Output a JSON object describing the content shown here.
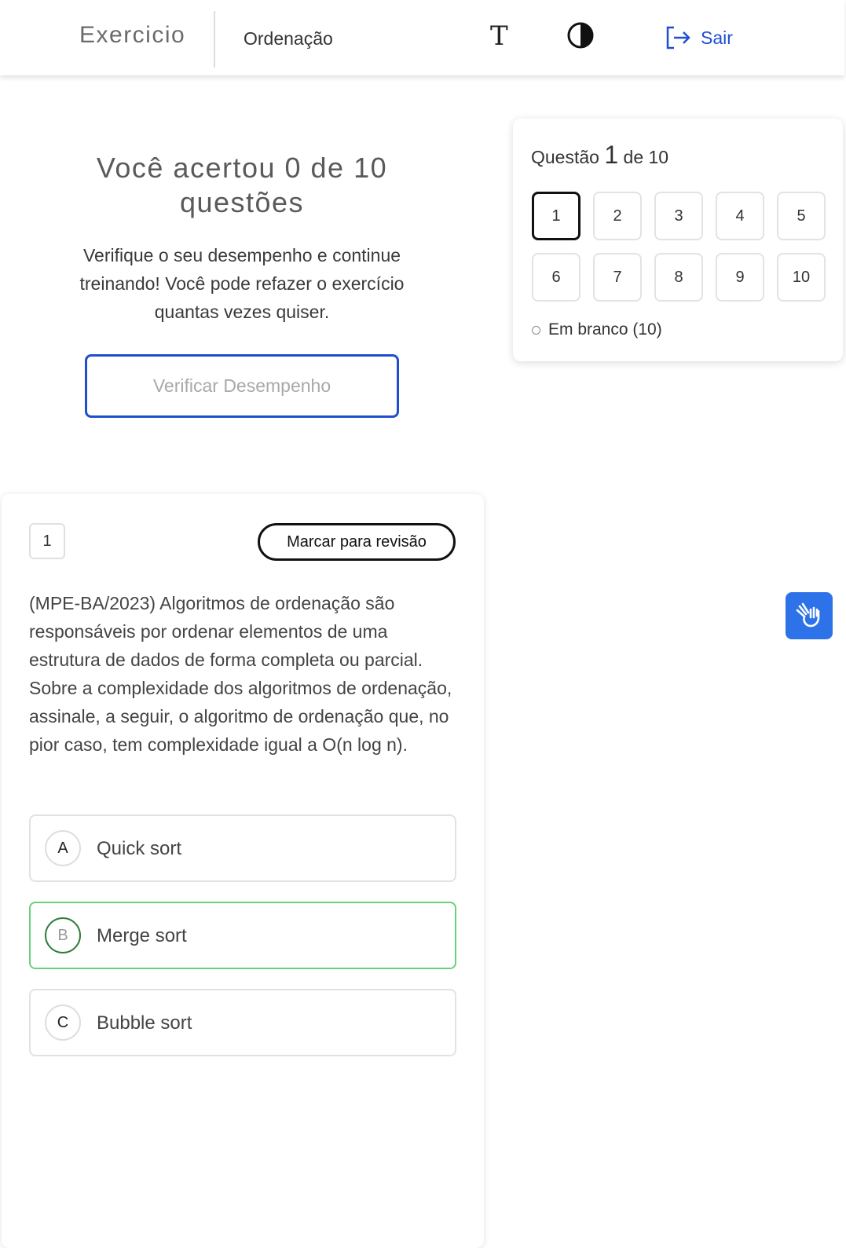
{
  "header": {
    "brand": "Exercicio",
    "subject": "Ordenação",
    "text_size_icon": "T",
    "logout_label": "Sair"
  },
  "result": {
    "title": "Você acertou 0 de 10 questões",
    "description": "Verifique o seu desempenho e continue treinando! Você pode refazer o exercício quantas vezes quiser.",
    "button_label": "Verificar Desempenho"
  },
  "navigator": {
    "title_prefix": "Questão",
    "current": "1",
    "title_suffix": "de 10",
    "questions": [
      "1",
      "2",
      "3",
      "4",
      "5",
      "6",
      "7",
      "8",
      "9",
      "10"
    ],
    "legend": "Em branco (10)"
  },
  "question": {
    "number": "1",
    "mark_label": "Marcar para revisão",
    "text": "(MPE-BA/2023) Algoritmos de ordenação são responsáveis por ordenar elementos de uma estrutura de dados de forma completa ou parcial. Sobre a complexidade dos algoritmos de ordenação, assinale, a seguir, o algoritmo de ordenação que, no pior caso, tem complexidade igual a O(n log n).",
    "options": [
      {
        "letter": "A",
        "text": "Quick sort"
      },
      {
        "letter": "B",
        "text": "Merge sort"
      },
      {
        "letter": "C",
        "text": "Bubble sort"
      }
    ]
  },
  "colors": {
    "accent": "#1e4fd1",
    "correct": "#6bd07a",
    "a11y": "#2d72e8"
  },
  "icons": {
    "text_size": "text-size-icon",
    "contrast": "contrast-icon",
    "logout": "logout-icon",
    "a11y": "sign-language-icon"
  }
}
